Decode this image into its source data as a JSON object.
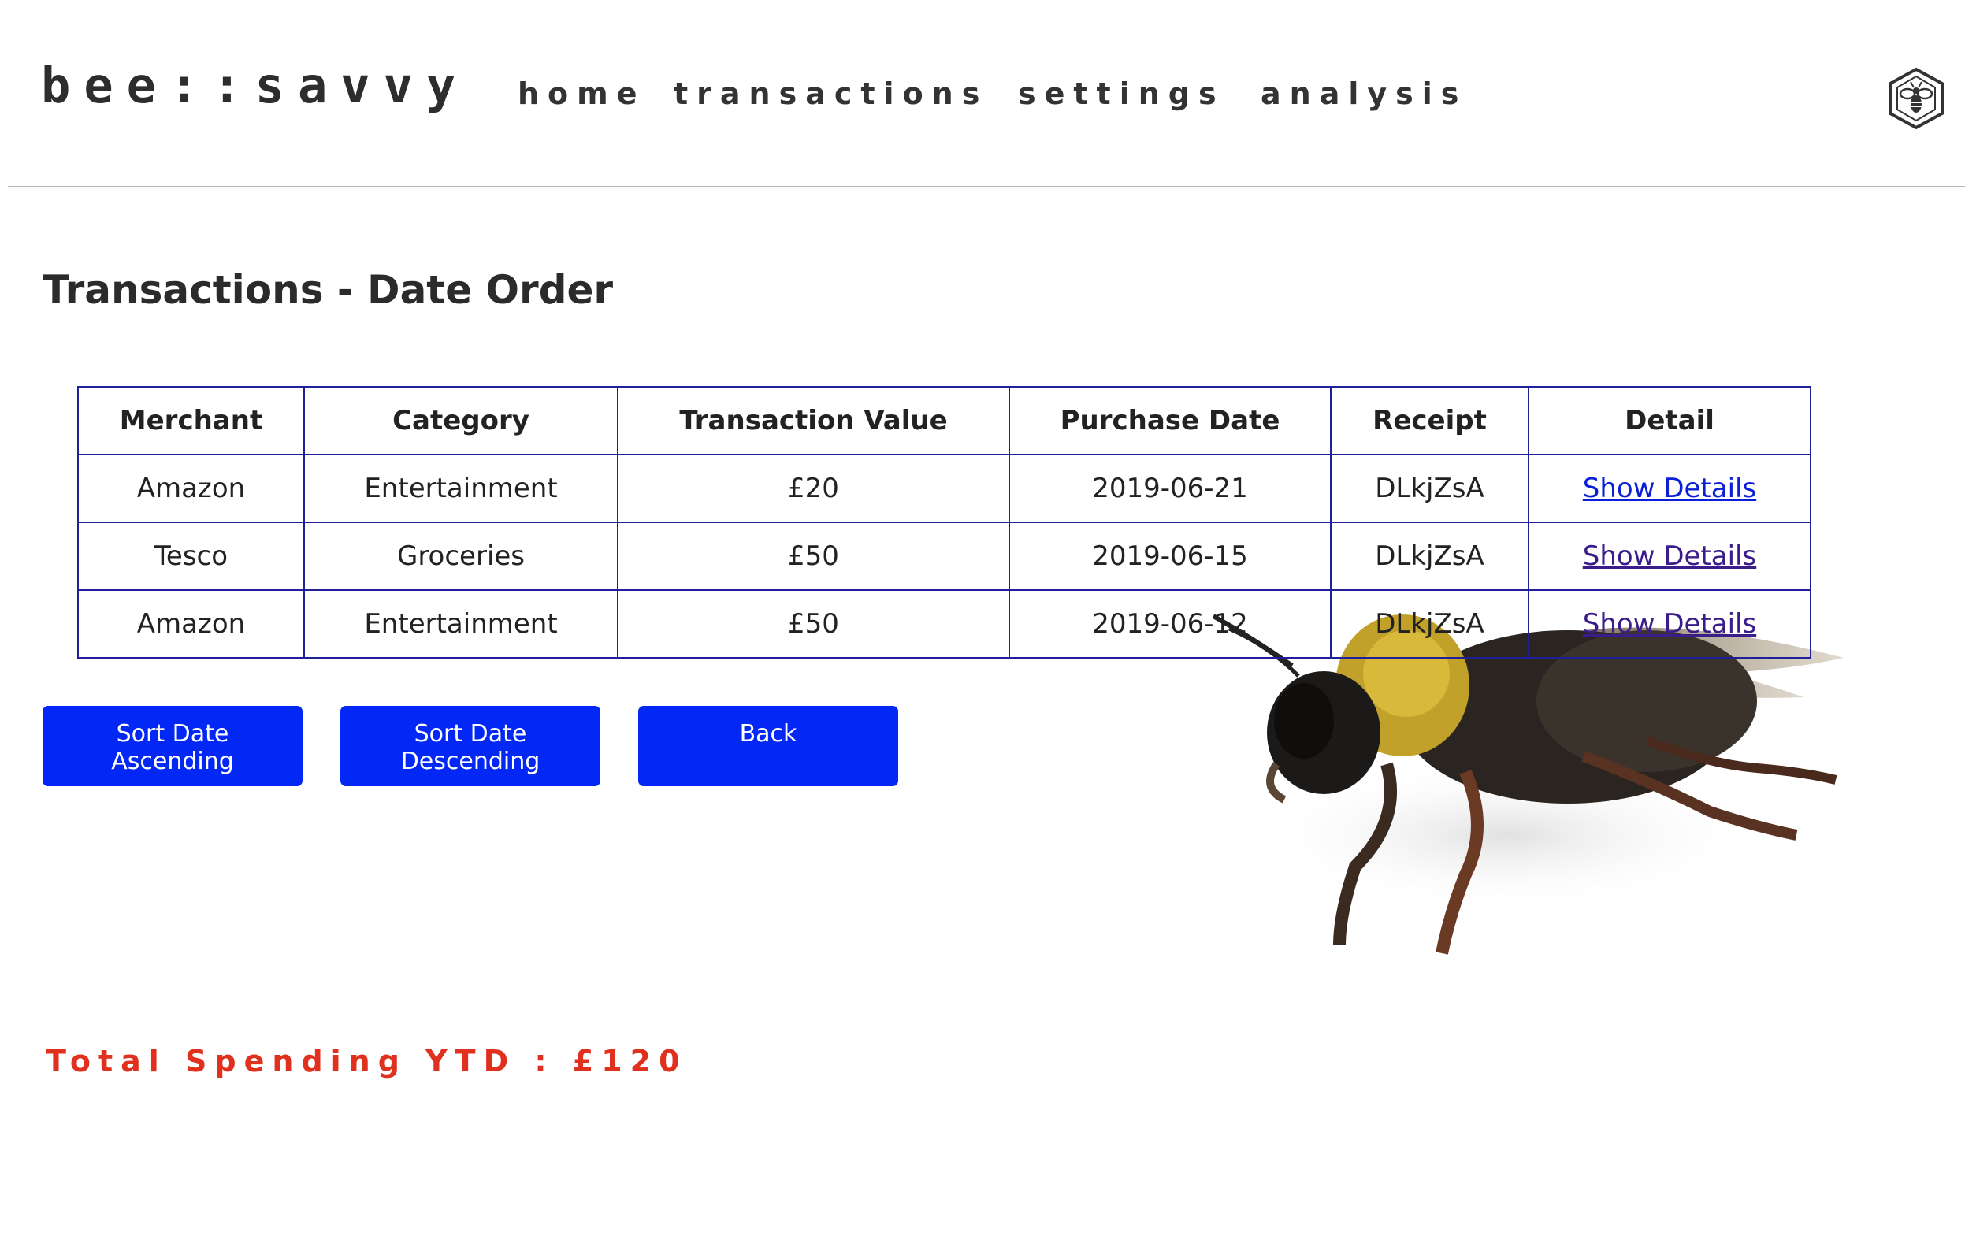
{
  "header": {
    "brand": "bee::savvy",
    "nav": [
      {
        "label": "home"
      },
      {
        "label": "transactions"
      },
      {
        "label": "settings"
      },
      {
        "label": "analysis"
      }
    ],
    "logo_icon": "bee-hexagon-icon"
  },
  "main": {
    "title": "Transactions - Date Order",
    "table": {
      "columns": [
        "Merchant",
        "Category",
        "Transaction Value",
        "Purchase Date",
        "Receipt",
        "Detail"
      ],
      "rows": [
        {
          "merchant": "Amazon",
          "category": "Entertainment",
          "value": "£20",
          "date": "2019-06-21",
          "receipt": "DLkjZsA",
          "detail": "Show Details"
        },
        {
          "merchant": "Tesco",
          "category": "Groceries",
          "value": "£50",
          "date": "2019-06-15",
          "receipt": "DLkjZsA",
          "detail": "Show Details"
        },
        {
          "merchant": "Amazon",
          "category": "Entertainment",
          "value": "£50",
          "date": "2019-06-12",
          "receipt": "DLkjZsA",
          "detail": "Show Details"
        }
      ]
    },
    "buttons": {
      "sort_asc": [
        "Sort Date",
        "Ascending"
      ],
      "sort_desc": [
        "Sort Date",
        "Descending"
      ],
      "back": "Back"
    },
    "total": "Total Spending YTD : £120"
  },
  "colors": {
    "accent": "#0328f5",
    "table_border": "#1f1f99",
    "link": "#0a1fd6",
    "link_visited": "#3a1d8a",
    "total_text": "#e0301e"
  },
  "decor": {
    "photo": "bumblebee-photo"
  }
}
